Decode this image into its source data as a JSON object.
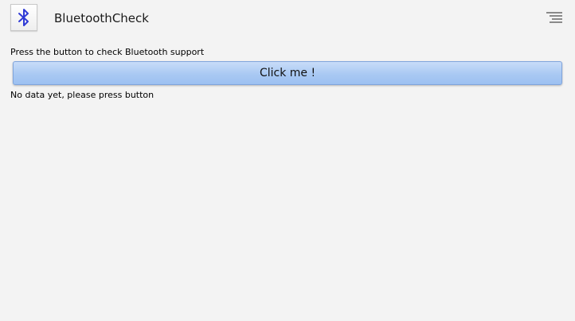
{
  "action_bar": {
    "title": "BluetoothCheck",
    "app_icon": "bluetooth-icon",
    "overflow_icon": "overflow-menu-icon"
  },
  "main": {
    "prompt": "Press the button to check Bluetooth support",
    "button_label": "Click me !",
    "result": "No data yet, please press button"
  },
  "colors": {
    "background": "#f3f3f3",
    "button_fill": "#a9c9f3",
    "button_border": "#7fa4dc",
    "icon_blue": "#2f3ad6"
  }
}
